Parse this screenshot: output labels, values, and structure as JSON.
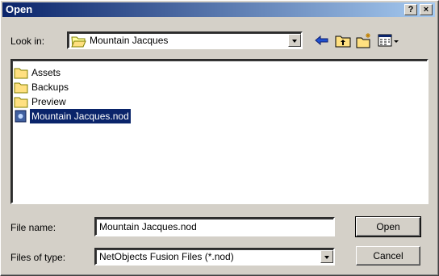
{
  "window": {
    "title": "Open"
  },
  "lookin": {
    "label": "Look in:",
    "value": "Mountain Jacques"
  },
  "files": [
    {
      "name": "Assets",
      "type": "folder-icon"
    },
    {
      "name": "Backups",
      "type": "folder-icon"
    },
    {
      "name": "Preview",
      "type": "folder-icon"
    },
    {
      "name": "Mountain Jacques.nod",
      "type": "document-icon",
      "selected": true
    }
  ],
  "filename": {
    "label": "File name:",
    "value": "Mountain Jacques.nod"
  },
  "filetype": {
    "label": "Files of type:",
    "value": "NetObjects Fusion Files (*.nod)"
  },
  "buttons": {
    "open": "Open",
    "cancel": "Cancel"
  },
  "titlebar": {
    "help": "?",
    "close": "×"
  },
  "colors": {
    "titlebar_start": "#0a246a",
    "titlebar_end": "#a6caf0",
    "selection": "#0a246a"
  }
}
